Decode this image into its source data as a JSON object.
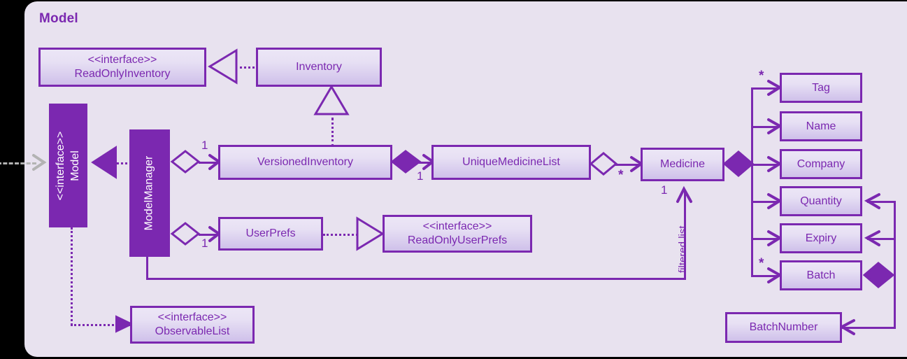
{
  "diagram": {
    "title": "Model",
    "type": "uml-class-diagram",
    "accent_color": "#7b28b0",
    "panel_color": "#e8e2ef",
    "box_fill_top": "#ece6f6",
    "box_fill_bottom": "#cfc0ea",
    "interface_stereotype": "<<interface>>",
    "external_arrow_color": "#b3b3b3"
  },
  "classes": {
    "read_only_inventory": {
      "stereotype": "<<interface>>",
      "name": "ReadOnlyInventory"
    },
    "inventory": {
      "name": "Inventory"
    },
    "model": {
      "stereotype": "<<interface>>",
      "name": "Model",
      "orientation": "vertical",
      "style": "solid"
    },
    "model_manager": {
      "name": "ModelManager",
      "orientation": "vertical",
      "style": "solid"
    },
    "versioned_inventory": {
      "name": "VersionedInventory"
    },
    "unique_medicine_list": {
      "name": "UniqueMedicineList"
    },
    "medicine": {
      "name": "Medicine"
    },
    "user_prefs": {
      "name": "UserPrefs"
    },
    "read_only_user_prefs": {
      "stereotype": "<<interface>>",
      "name": "ReadOnlyUserPrefs"
    },
    "observable_list": {
      "stereotype": "<<interface>>",
      "name": "ObservableList"
    },
    "tag": {
      "name": "Tag"
    },
    "name_attr": {
      "name": "Name"
    },
    "company": {
      "name": "Company"
    },
    "quantity": {
      "name": "Quantity"
    },
    "expiry": {
      "name": "Expiry"
    },
    "batch": {
      "name": "Batch"
    },
    "batch_number": {
      "name": "BatchNumber"
    }
  },
  "multiplicities": {
    "mm_versioned": "1",
    "mm_userprefs": "1",
    "versioned_uml": "1",
    "uml_medicine": "*",
    "medicine_filtered": "1",
    "medicine_tag": "*",
    "medicine_batch": "*"
  },
  "labels": {
    "filtered_list": "filtered list"
  }
}
